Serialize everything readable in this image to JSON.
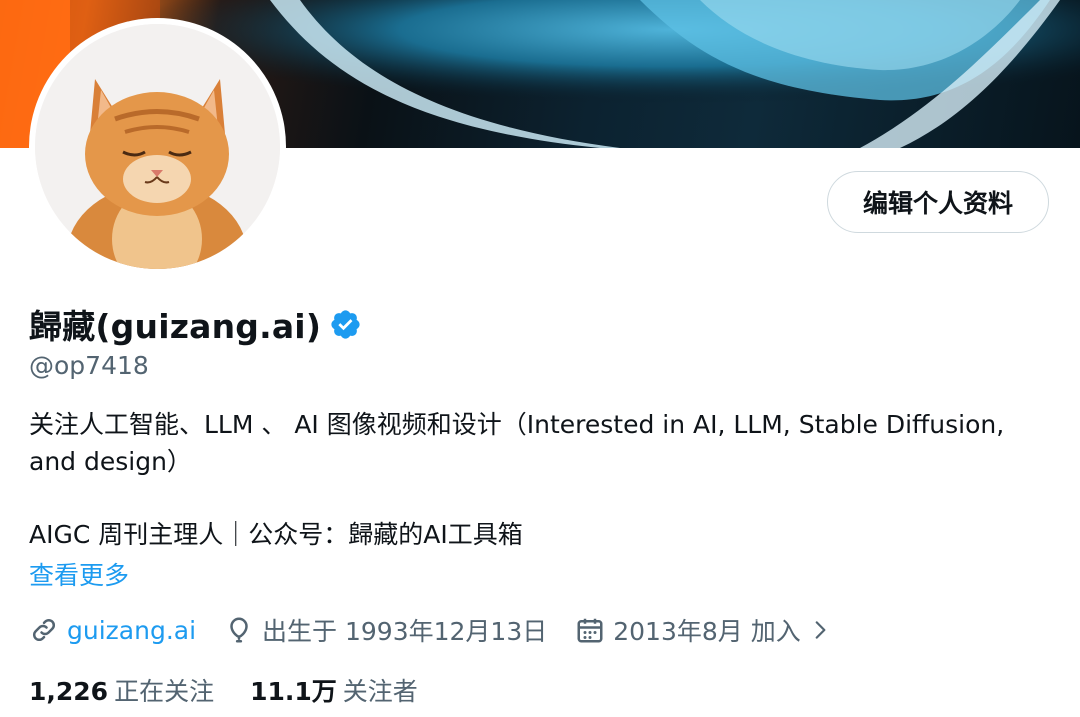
{
  "profile": {
    "edit_button": "编辑个人资料",
    "display_name": "歸藏(guizang.ai)",
    "handle": "@op7418",
    "bio": "关注人工智能、LLM 、 AI 图像视频和设计（Interested in AI, LLM, Stable Diffusion,\nand design）",
    "bio_line2": "AIGC 周刊主理人｜公众号：歸藏的AI工具箱",
    "see_more": "查看更多",
    "website": "guizang.ai",
    "birthday": "出生于 1993年12月13日",
    "joined": "2013年8月 加入",
    "following_count": "1,226",
    "following_label": "正在关注",
    "followers_count": "11.1万",
    "followers_label": "关注者"
  },
  "icons": {
    "verified": "verified-badge-icon",
    "link": "link-icon",
    "birthday": "balloon-icon",
    "joined": "calendar-icon",
    "chevron": "chevron-right-icon"
  },
  "colors": {
    "accent": "#1d9bf0",
    "secondary_text": "#536471",
    "primary_text": "#0f1419"
  }
}
